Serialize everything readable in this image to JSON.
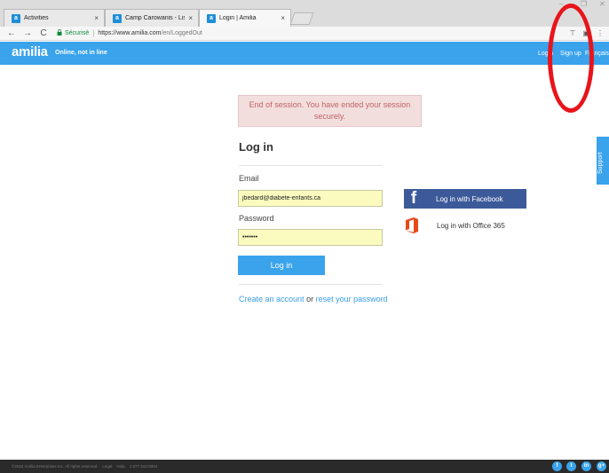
{
  "browser": {
    "tabs": [
      {
        "title": "Activities",
        "active": false
      },
      {
        "title": "Camp Carowanis - List o",
        "active": false
      },
      {
        "title": "Login | Amilia",
        "active": true
      }
    ],
    "tab_favicon": "a",
    "tab_close": "×",
    "window_controls": {
      "minimize": "–",
      "restore": "❐",
      "close": "✕"
    },
    "nav": {
      "back": "←",
      "forward": "→",
      "reload": "C"
    },
    "secure_label": "Sécurisé",
    "url_host": "https://www.amilia.com",
    "url_path": "/en/LoggedOut",
    "toolbar_icons": [
      "filter-icon",
      "extension-icon",
      "menu-icon"
    ]
  },
  "header": {
    "logo": "amilia",
    "tagline": "Online, not in line",
    "nav": {
      "login": "Login",
      "signup": "Sign up",
      "language": "Français"
    },
    "accent_color": "#3aa3ec"
  },
  "session_message": "End of session. You have ended your session securely.",
  "login": {
    "title": "Log in",
    "email_label": "Email",
    "email_value": "jbedard@diabete-enfants.ca",
    "password_label": "Password",
    "password_value": "•••••••",
    "submit_label": "Log in"
  },
  "links": {
    "create_account": "Create an account",
    "or_text": "or",
    "reset_password": "reset your password"
  },
  "social_login": {
    "facebook_label": "Log in with Facebook",
    "facebook_glyph": "f",
    "office_label": "Log in with Office 365",
    "facebook_color": "#3c5a99",
    "office_color": "#e64a19"
  },
  "support_label": "Support",
  "footer": {
    "copyright": "©2016 Amilia Enterprises Inc. All rights reserved.",
    "legal": "Legal",
    "help": "Help",
    "phone": "1 877 343-0004",
    "social": [
      "f",
      "t",
      "in",
      "g+"
    ]
  },
  "annotation_color": "#e8141c"
}
